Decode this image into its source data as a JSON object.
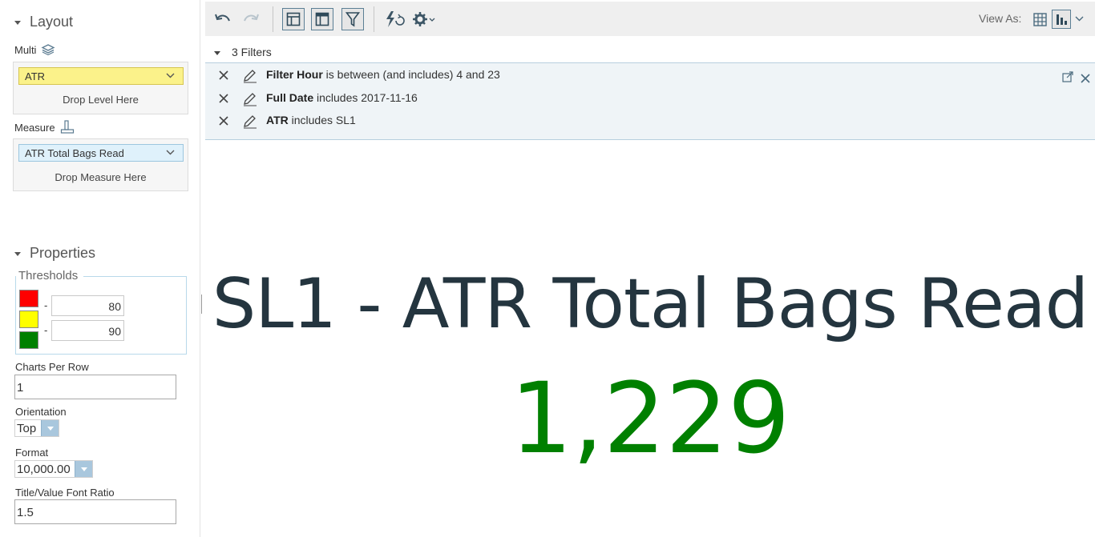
{
  "layout": {
    "section_title": "Layout",
    "multi_label": "Multi",
    "multi_pill": "ATR",
    "drop_level_hint": "Drop Level Here",
    "measure_label": "Measure",
    "measure_pill": "ATR Total Bags Read",
    "drop_measure_hint": "Drop Measure Here"
  },
  "properties": {
    "section_title": "Properties",
    "thresholds_legend": "Thresholds",
    "thresholds": {
      "colors": [
        "#ff0000",
        "#ffff00",
        "#008000"
      ],
      "dash": "-",
      "low": "80",
      "high": "90"
    },
    "charts_per_row_label": "Charts Per Row",
    "charts_per_row_value": "1",
    "orientation_label": "Orientation",
    "orientation_value": "Top",
    "format_label": "Format",
    "format_value": "10,000.00",
    "font_ratio_label": "Title/Value Font Ratio",
    "font_ratio_value": "1.5"
  },
  "toolbar": {
    "view_as_label": "View As:",
    "icons": [
      "undo-icon",
      "redo-icon",
      "layout-icon",
      "table-layout-icon",
      "filter-icon",
      "refresh-icon",
      "settings-icon",
      "grid-view-icon",
      "chart-view-icon"
    ]
  },
  "filters": {
    "header": "3 Filters",
    "items": [
      {
        "field": "Filter Hour",
        "condition": " is between (and includes) 4 and 23"
      },
      {
        "field": "Full Date",
        "condition": " includes 2017-11-16"
      },
      {
        "field": "ATR",
        "condition": " includes SL1"
      }
    ]
  },
  "kpi": {
    "title": "SL1 - ATR Total Bags Read",
    "value": "1,229",
    "value_color": "#008000"
  }
}
